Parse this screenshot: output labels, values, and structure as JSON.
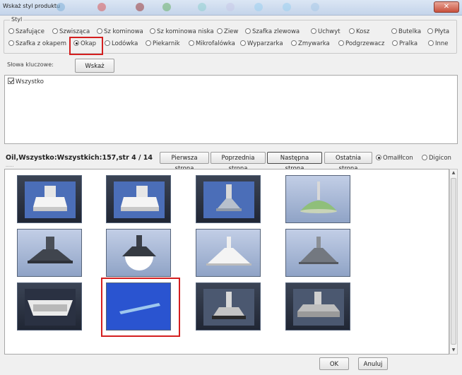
{
  "window": {
    "title": "Wskaż styl produktu",
    "close_symbol": "✕"
  },
  "style_group": {
    "legend": "Styl",
    "row1": [
      "Szafujące",
      "Szwisząca",
      "Sz kominowa",
      "Sz kominowa niska",
      "Ziew",
      "Szafka zlewowa",
      "Uchwyt",
      "Kosz",
      "Butelka",
      "Płyta"
    ],
    "row2": [
      "Szafka z okapem",
      "Okap",
      "Lodówka",
      "Piekarnik",
      "Mikrofalówka",
      "Wyparzarka",
      "Zmywarka",
      "Podgrzewacz",
      "Pralka",
      "Inne"
    ],
    "selected": "Okap"
  },
  "keywords": {
    "label": "Słowa kluczowe:",
    "show_button": "Wskaż",
    "items": [
      {
        "label": "Wszystko",
        "checked": true
      }
    ]
  },
  "pager": {
    "info": "Oil,Wszystko:Wszystkich:157,str 4 / 14",
    "sub": "......",
    "first": "Pierwsza strona",
    "prev": "Poprzednia strona",
    "next": "Następna strona",
    "last": "Ostatnia strona",
    "view_options": [
      "OmaIłłcon",
      "Digicon"
    ],
    "view_selected": "OmaIłłcon"
  },
  "grid": {
    "selected_index": 8
  },
  "buttons": {
    "ok": "OK",
    "cancel": "Anuluj"
  },
  "colors": {
    "highlight": "#d41f1f",
    "selected_tile": "#2a54d0"
  }
}
